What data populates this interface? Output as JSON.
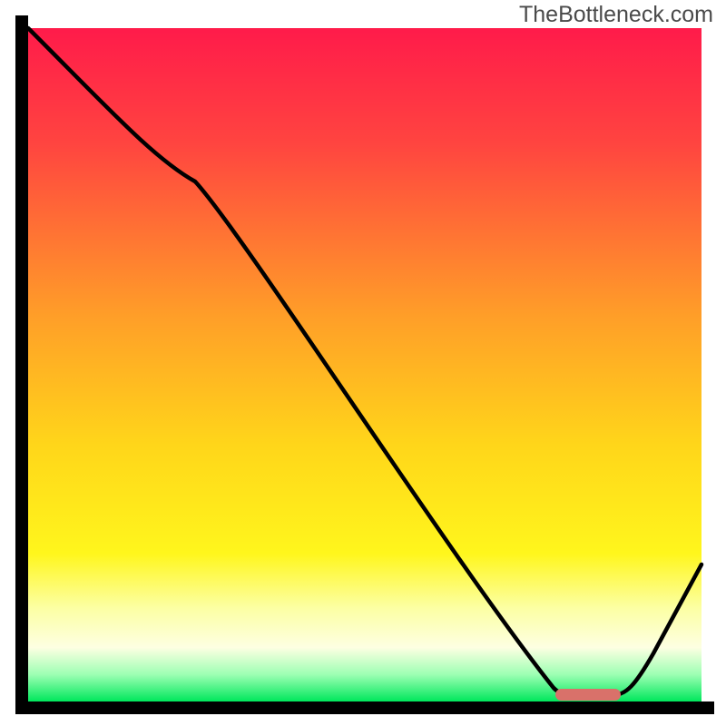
{
  "watermark": "TheBottleneck.com",
  "chart_data": {
    "type": "line",
    "title": "",
    "xlabel": "",
    "ylabel": "",
    "xlim": [
      0,
      100
    ],
    "ylim": [
      0,
      100
    ],
    "x": [
      0,
      25,
      78,
      86,
      100
    ],
    "y": [
      100,
      78,
      1,
      1,
      22
    ],
    "marker": {
      "x": 81,
      "y": 0.7,
      "color": "#d9716a",
      "width": 9,
      "height": 1.2,
      "shape": "pill"
    },
    "gradient_stops": [
      {
        "offset": 0,
        "color": "#ff1b4a"
      },
      {
        "offset": 17,
        "color": "#ff4440"
      },
      {
        "offset": 43,
        "color": "#ff9f28"
      },
      {
        "offset": 62,
        "color": "#ffd61a"
      },
      {
        "offset": 78,
        "color": "#fff61c"
      },
      {
        "offset": 86,
        "color": "#fcffa2"
      },
      {
        "offset": 92,
        "color": "#fdffe2"
      },
      {
        "offset": 96,
        "color": "#9dffb3"
      },
      {
        "offset": 100,
        "color": "#00e75c"
      }
    ],
    "legend": null,
    "grid": false
  }
}
